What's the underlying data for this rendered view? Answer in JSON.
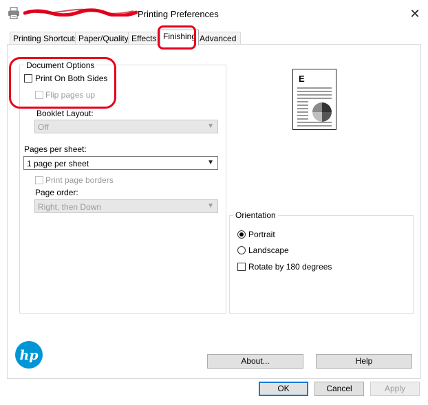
{
  "window": {
    "title": "Printing Preferences",
    "close_glyph": "✕"
  },
  "tabs": [
    {
      "label": "Printing Shortcuts"
    },
    {
      "label": "Paper/Quality"
    },
    {
      "label": "Effects"
    },
    {
      "label": "Finishing"
    },
    {
      "label": "Advanced"
    }
  ],
  "active_tab": "Finishing",
  "document_options": {
    "group_title": "Document Options",
    "print_both_sides": {
      "label": "Print On Both Sides",
      "checked": false
    },
    "flip_pages_up": {
      "label": "Flip pages up",
      "checked": false,
      "enabled": false
    },
    "booklet_layout": {
      "label": "Booklet Layout:",
      "value": "Off",
      "enabled": false
    },
    "pages_per_sheet": {
      "label": "Pages per sheet:",
      "value": "1 page per sheet"
    },
    "print_page_borders": {
      "label": "Print page borders",
      "checked": false,
      "enabled": false
    },
    "page_order": {
      "label": "Page order:",
      "value": "Right, then Down",
      "enabled": false
    }
  },
  "preview": {
    "page_letter": "E"
  },
  "orientation": {
    "group_title": "Orientation",
    "portrait": {
      "label": "Portrait",
      "checked": true
    },
    "landscape": {
      "label": "Landscape",
      "checked": false
    },
    "rotate": {
      "label": "Rotate by 180 degrees",
      "checked": false
    }
  },
  "buttons": {
    "about": "About...",
    "help": "Help",
    "ok": "OK",
    "cancel": "Cancel",
    "apply": "Apply"
  },
  "colors": {
    "highlight_red": "#e8001c",
    "hp_blue": "#0096d6",
    "focus_blue": "#0078d7"
  },
  "icons": {
    "printer": "printer-icon",
    "hp_logo": "hp-logo"
  }
}
